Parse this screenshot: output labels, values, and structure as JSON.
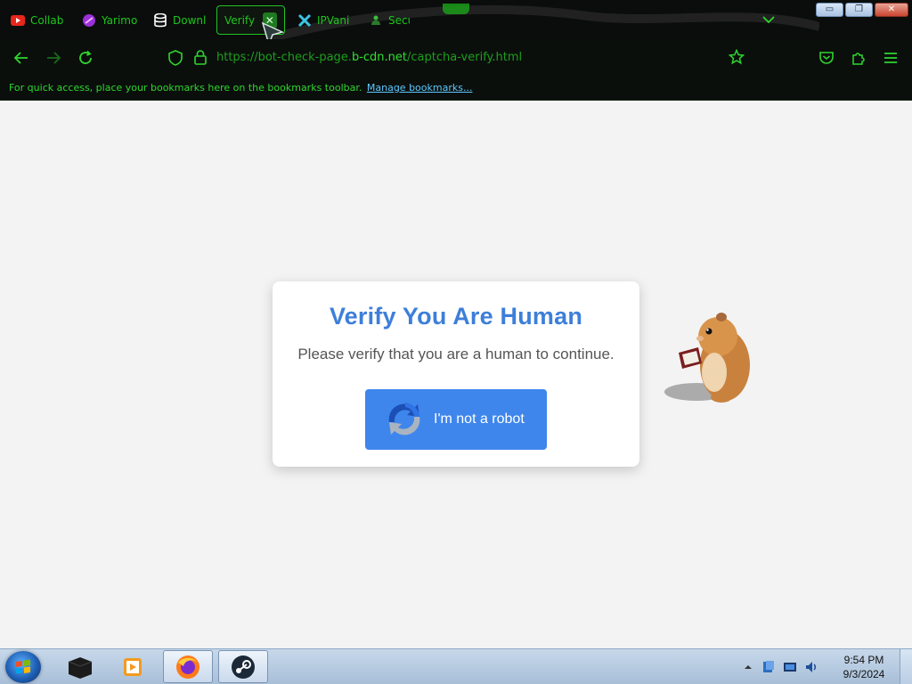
{
  "browser": {
    "tabs": [
      {
        "label": "Collab",
        "icon": "youtube-icon",
        "active": false
      },
      {
        "label": "Yarimo",
        "icon": "yarimo-icon",
        "active": false
      },
      {
        "label": "Downl",
        "icon": "database-icon",
        "active": false
      },
      {
        "label": "Verify Y",
        "icon": "",
        "active": true
      },
      {
        "label": "IPVani",
        "icon": "ipvanish-icon",
        "active": false
      },
      {
        "label": "Secur",
        "icon": "security-icon",
        "active": false
      }
    ],
    "url_prefix": "https://bot-check-page.",
    "url_domain": "b-cdn.net",
    "url_suffix": "/captcha-verify.html",
    "bookmarks_message": "For quick access, place your bookmarks here on the bookmarks toolbar.",
    "manage_bookmarks": "Manage bookmarks..."
  },
  "page": {
    "title": "Verify You Are Human",
    "message": "Please verify that you are a human to continue.",
    "button_label": "I'm not a robot"
  },
  "taskbar": {
    "time": "9:54 PM",
    "date": "9/3/2024"
  },
  "colors": {
    "accent_green": "#2ed62e",
    "title_blue": "#3d7fd9",
    "button_blue": "#3f86ec"
  }
}
